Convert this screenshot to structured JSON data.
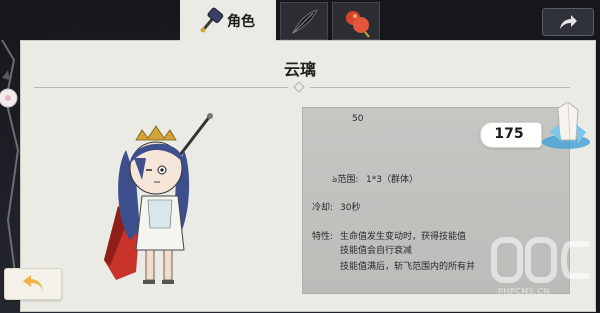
{
  "tabs": [
    {
      "id": "character",
      "label": "角色",
      "active": true,
      "icon": "hammer-icon"
    },
    {
      "id": "weapon",
      "label": "",
      "active": false,
      "icon": "feather-icon"
    },
    {
      "id": "item",
      "label": "",
      "active": false,
      "icon": "gourd-icon"
    }
  ],
  "share_button": {
    "icon": "share-arrow-icon"
  },
  "character": {
    "name": "云璃",
    "cost": "175",
    "stats": {
      "value_top": "50",
      "range_label": "ঌ范围:",
      "range_value": "1*3（群体）",
      "cd_label": "冷却:",
      "cd_value": "30秒",
      "trait_label": "特性:",
      "trait_line1": "生命值发生变动时，获得技能值",
      "trait_line2": "技能值会自行衰减",
      "trait_line3": "技能值满后，斩飞范围内的所有并"
    }
  },
  "back_button": {
    "icon": "back-arrow-icon"
  },
  "watermark": {
    "text": "PHPCMS.CN"
  },
  "colors": {
    "panel": "#ebebe6",
    "info_box": "#c3c3c0",
    "frame": "#1b1d24",
    "crystal": "#7ec7e8",
    "cape": "#c8342a",
    "hair": "#3d4f8c"
  }
}
